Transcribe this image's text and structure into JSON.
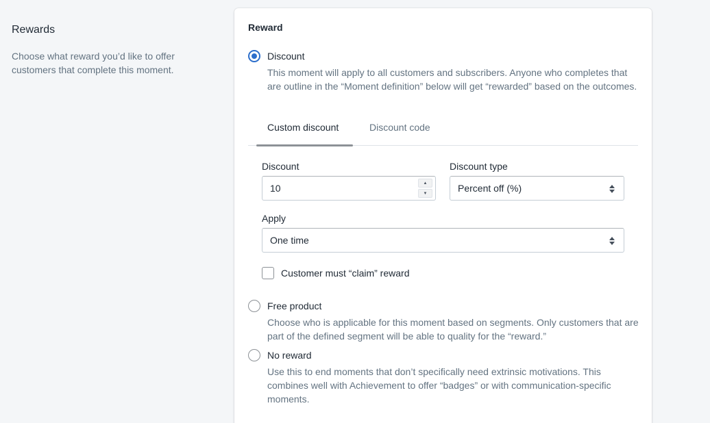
{
  "sidebar": {
    "title": "Rewards",
    "description": "Choose what reward you’d like to offer customers that complete this moment."
  },
  "card": {
    "heading": "Reward",
    "options": [
      {
        "label": "Discount",
        "selected": true,
        "help": "This moment will apply to all customers and subscribers. Anyone who completes that are outline in the “Moment definition” below will get “rewarded” based on the outcomes."
      },
      {
        "label": "Free product",
        "selected": false,
        "help": "Choose who is applicable for this moment based on segments. Only customers that are part of the defined segment will be able to quality for the “reward.”"
      },
      {
        "label": "No reward",
        "selected": false,
        "help": "Use this to end moments that don’t specifically need extrinsic motivations. This combines well with Achievement to offer “badges” or with communication-specific moments."
      }
    ],
    "tabs": [
      {
        "label": "Custom discount",
        "active": true
      },
      {
        "label": "Discount code",
        "active": false
      }
    ],
    "discount": {
      "label": "Discount",
      "value": "10"
    },
    "discount_type": {
      "label": "Discount type",
      "value": "Percent off (%)"
    },
    "apply": {
      "label": "Apply",
      "value": "One time"
    },
    "claim_checkbox": {
      "label": "Customer must “claim” reward",
      "checked": false
    }
  },
  "colors": {
    "accent": "#2c6ecb",
    "text": "#212b36",
    "subdued_text": "#637381",
    "background": "#f4f6f8"
  }
}
